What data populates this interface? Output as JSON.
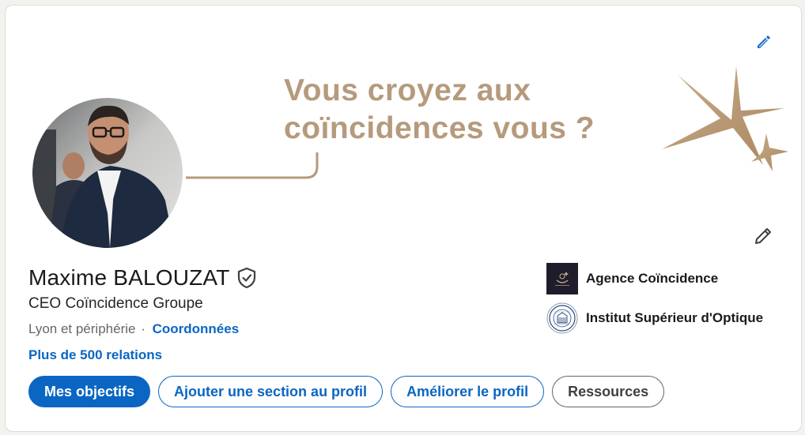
{
  "banner": {
    "headline_line1": "Vous croyez aux",
    "headline_line2": "coïncidences vous ?",
    "accent_color": "#b59a7c"
  },
  "profile": {
    "name": "Maxime BALOUZAT",
    "headline": "CEO Coïncidence Groupe",
    "location": "Lyon et périphérie",
    "separator": "·",
    "contact_link": "Coordonnées",
    "connections": "Plus de 500 relations"
  },
  "organizations": [
    {
      "name": "Agence Coïncidence",
      "logo": "agence-coincidence-logo"
    },
    {
      "name": "Institut Supérieur d'Optique",
      "logo": "institut-optique-logo"
    }
  ],
  "actions": {
    "goals": "Mes objectifs",
    "add_section": "Ajouter une section au profil",
    "improve": "Améliorer le profil",
    "resources": "Ressources"
  },
  "icons": {
    "edit_banner": "pencil-icon",
    "edit_intro": "pencil-icon",
    "verified": "verified-shield-icon"
  },
  "colors": {
    "link": "#0a66c2",
    "text": "#1a1a1a",
    "muted": "#666666"
  }
}
